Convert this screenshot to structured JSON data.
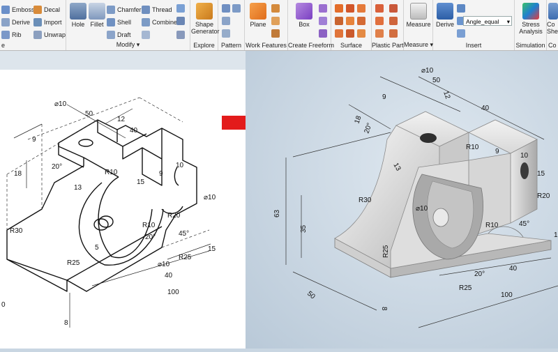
{
  "ribbon": {
    "create_buttons": [
      "Emboss",
      "Derive",
      "Rib",
      "Decal",
      "Import",
      "Unwrap"
    ],
    "create_label": "e",
    "modify_large": [
      "Hole",
      "Fillet"
    ],
    "modify_small": [
      "Chamfer",
      "Shell",
      "Draft",
      "Thread",
      "Combine"
    ],
    "modify_label": "Modify ▾",
    "explore_button": "Shape Generator",
    "explore_label": "Explore",
    "pattern_label": "Pattern",
    "plane_button": "Plane",
    "work_features_label": "Work Features",
    "box_button": "Box",
    "freeform_label": "Create Freeform",
    "surface_label": "Surface",
    "plastic_label": "Plastic Part",
    "measure_button": "Measure",
    "measure_label": "Measure ▾",
    "derive_button": "Derive",
    "insert_dropdown": "Angle_equal",
    "insert_label": "Insert",
    "stress_button": "Stress Analysis",
    "simulation_label": "Simulation",
    "convert_button": "Co She",
    "convert_label": "Co"
  },
  "left_dims": {
    "d1": "⌀10",
    "d2": "50",
    "d3": "12",
    "d4": "40",
    "d5": "9",
    "d6": "20°",
    "d7": "18",
    "d8": "R10",
    "d9": "9",
    "d10": "10",
    "d11": "13",
    "d12": "15",
    "d13": "R20",
    "d14": "⌀10",
    "d15": "R30",
    "d16": "R10",
    "d17": "20°",
    "d18": "45°",
    "d19": "⌀10",
    "d20": "R25",
    "d21": "R25",
    "d22": "15",
    "d23": "40",
    "d24": "100",
    "d25": "8",
    "d26": "5",
    "d27": "0"
  },
  "right_dims": {
    "d1": "⌀10",
    "d2": "50",
    "d3": "12",
    "d4": "9",
    "d5": "40",
    "d6": "18",
    "d7": "20°",
    "d8": "13",
    "d9": "R10",
    "d10": "10",
    "d11": "9",
    "d12": "15",
    "d13": "R30",
    "d14": "⌀10",
    "d15": "R20",
    "d16": "63",
    "d17": "35",
    "d18": "R10",
    "d19": "45°",
    "d20": "R25",
    "d21": "20°",
    "d22": "40",
    "d23": "50",
    "d24": "R25",
    "d25": "8",
    "d26": "100",
    "d27": "1"
  },
  "arrow_color": "#e31b1b"
}
